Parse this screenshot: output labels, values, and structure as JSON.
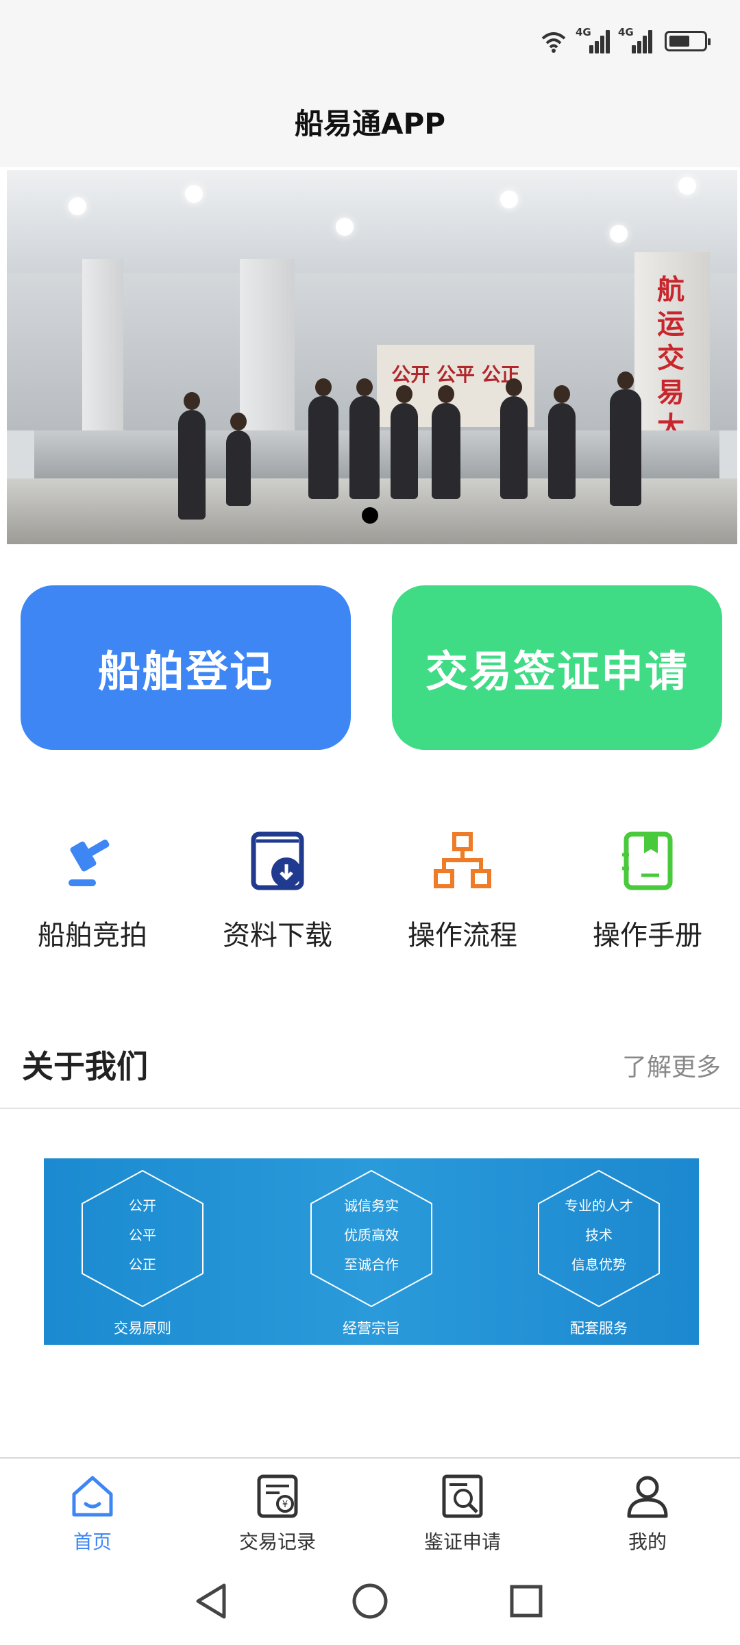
{
  "status_bar": {
    "network_1": "4G",
    "network_2": "4G",
    "battery_level": 0.6
  },
  "header": {
    "title": "船易通APP"
  },
  "banner": {
    "wall_sign": "公开 公平 公正",
    "pillar_sign": "航运交易大厅",
    "page_indicator_count": 1,
    "page_indicator_active": 0
  },
  "actions": {
    "ship_registration": "船舶登记",
    "trade_visa_application": "交易签证申请"
  },
  "quick_links": [
    {
      "label": "船舶竞拍",
      "icon": "gavel-icon"
    },
    {
      "label": "资料下载",
      "icon": "download-icon"
    },
    {
      "label": "操作流程",
      "icon": "flowchart-icon"
    },
    {
      "label": "操作手册",
      "icon": "manual-icon"
    }
  ],
  "about": {
    "title": "关于我们",
    "more": "了解更多",
    "columns": [
      {
        "lines": [
          "公开",
          "公平",
          "公正"
        ],
        "caption": "交易原则"
      },
      {
        "lines": [
          "诚信务实",
          "优质高效",
          "至诚合作"
        ],
        "caption": "经营宗旨"
      },
      {
        "lines": [
          "专业的人才",
          "技术",
          "信息优势"
        ],
        "caption": "配套服务"
      }
    ]
  },
  "bottom_nav": [
    {
      "label": "首页",
      "icon": "home-icon",
      "active": true
    },
    {
      "label": "交易记录",
      "icon": "transaction-record-icon",
      "active": false
    },
    {
      "label": "鉴证申请",
      "icon": "verification-search-icon",
      "active": false
    },
    {
      "label": "我的",
      "icon": "user-icon",
      "active": false
    }
  ],
  "colors": {
    "primary_blue": "#3d86f4",
    "primary_green": "#3fdb85",
    "icon_navy": "#1f3a8f",
    "icon_orange": "#ee7b27",
    "icon_lime": "#49c93c",
    "about_banner": "#2a9ada"
  }
}
